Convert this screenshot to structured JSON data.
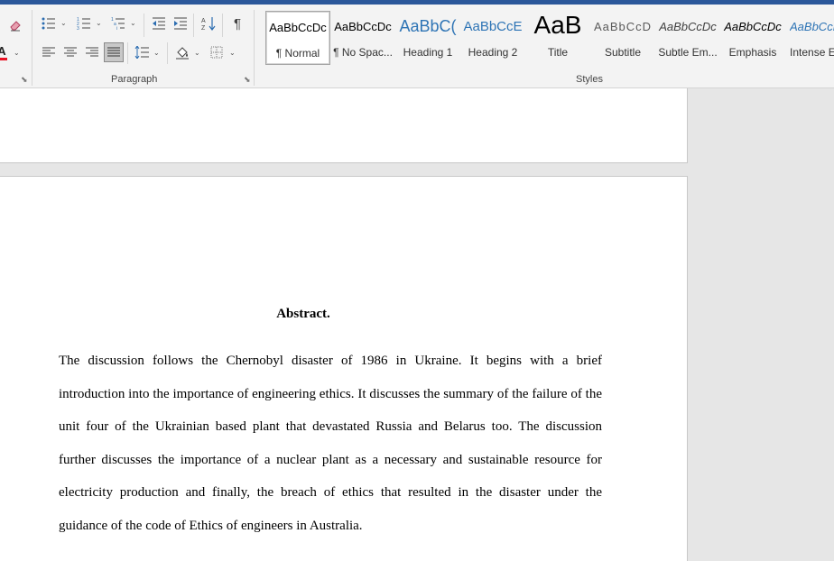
{
  "colors": {
    "titlebar": "#2b579a",
    "ribbon": "#f3f3f3",
    "font_color_red": "#e81123",
    "heading_blue": "#2e74b5"
  },
  "ribbon": {
    "paragraph_group_label": "Paragraph",
    "styles_group_label": "Styles",
    "icons": [
      "eraser-icon",
      "font-color-icon",
      "bullets-icon",
      "numbering-icon",
      "multilevel-list-icon",
      "decrease-indent-icon",
      "increase-indent-icon",
      "sort-icon",
      "show-marks-icon",
      "align-left-icon",
      "center-icon",
      "align-right-icon",
      "justify-icon",
      "line-spacing-icon",
      "shading-icon",
      "borders-icon"
    ],
    "font_color_letter": "A",
    "styles": [
      {
        "preview": "AaBbCcDc",
        "name": "¶ Normal"
      },
      {
        "preview": "AaBbCcDc",
        "name": "¶ No Spac..."
      },
      {
        "preview": "AaBbC(",
        "name": "Heading 1"
      },
      {
        "preview": "AaBbCcE",
        "name": "Heading 2"
      },
      {
        "preview": "AaB",
        "name": "Title"
      },
      {
        "preview": "AaBbCcD",
        "name": "Subtitle"
      },
      {
        "preview": "AaBbCcDc",
        "name": "Subtle Em..."
      },
      {
        "preview": "AaBbCcDc",
        "name": "Emphasis"
      },
      {
        "preview": "AaBbCcDc",
        "name": "Intense E"
      }
    ]
  },
  "document": {
    "heading": "Abstract.",
    "paragraph": "The discussion follows the Chernobyl disaster of 1986 in Ukraine. It begins with a brief introduction into the importance of engineering ethics. It discusses the summary of the failure of the unit four of the Ukrainian based plant that devastated Russia and Belarus too. The discussion further discusses the importance of a nuclear plant as a necessary and sustainable resource for electricity production and finally, the breach of ethics that resulted in the disaster under the guidance of the code of Ethics of engineers in Australia."
  }
}
